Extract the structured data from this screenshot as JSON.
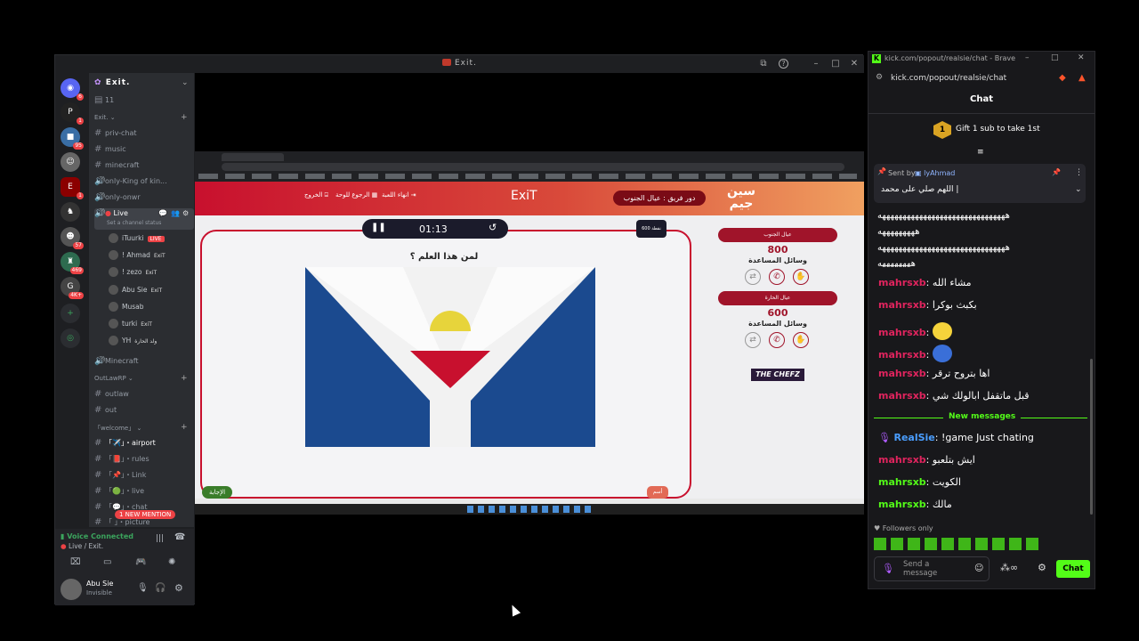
{
  "discord": {
    "window_title": "Exit.",
    "server_name": "Exit.",
    "channels": {
      "c11": "11",
      "category": "Exit.",
      "priv_chat": "priv-chat",
      "music": "music",
      "minecraft": "minecraft",
      "only_king": "only-King of kin...",
      "only_onwr": "only-onwr",
      "live": "Live",
      "live_status": "Set a channel status",
      "minecraft_voice": "Minecraft",
      "outlaw_category": "OutLawRP",
      "outlaw": "outlaw",
      "out": "out",
      "welcome_category": "「welcome」",
      "airport": "「✈️」・airport",
      "rules": "「📕」・rules",
      "link": "「📌」・Link",
      "live2": "「🟢」・live",
      "chat": "「💬」・chat",
      "last": "「 」・picture"
    },
    "voice_users": [
      {
        "name": "iTuurki",
        "tag": "LIVE"
      },
      {
        "name": "! Ahmad",
        "tag": "ExiT"
      },
      {
        "name": "! zezo",
        "tag": "ExiT"
      },
      {
        "name": "Abu Sie",
        "tag": "ExiT"
      },
      {
        "name": "Musab",
        "tag": ""
      },
      {
        "name": "turki",
        "tag": "ExiT"
      },
      {
        "name": "YH",
        "tag": "ولد الحارة"
      }
    ],
    "new_mention": "1 NEW MENTION",
    "voice_connected": "Voice Connected",
    "voice_location": "Live / Exit.",
    "user": {
      "name": "Abu Sie",
      "status": "Invisible"
    },
    "server_badges": [
      "6",
      "1",
      "95",
      "1",
      "57",
      "469",
      "4K+"
    ]
  },
  "game": {
    "title": "ExiT",
    "team_turn": "دور فريق : عيال الجنوب",
    "end_game": "انهاء اللعبة",
    "back_board": "الرجوع للوحة",
    "exit": "الخروج",
    "timer": "01:13",
    "points_badge": "600 نقطة",
    "question": "لمن هذا العلم ؟",
    "answer_btn": "الإجابة",
    "team_btn": "أسم",
    "team1": {
      "name": "عيال الجنوب",
      "score": "800",
      "helpers": "وسائل المساعدة"
    },
    "team2": {
      "name": "عيال الحارة",
      "score": "600",
      "helpers": "وسائل المساعدة"
    },
    "sponsor": "THE CHEFZ",
    "logo": "سين جيم"
  },
  "kick": {
    "window_title": "kick.com/popout/realsie/chat - Brave",
    "url": "kick.com/popout/realsie/chat",
    "header": "Chat",
    "gift_text": "Gift 1 sub to take 1st",
    "pinned_by_label": "Sent by",
    "pinned_user": "lyAhmad",
    "pinned_text": "اللهم صلي على محمد |",
    "spam1": "هههههههههههههههههههههههههههههههه",
    "spam1b": "هههههههههه",
    "spam2": "هههههههههههههههههههههههههههههههه",
    "spam2b": "ههههههههه",
    "new_messages": "New messages",
    "messages": [
      {
        "user": "mahrsxb",
        "text": "مشاء الله",
        "color": "#e0245e"
      },
      {
        "user": "mahrsxb",
        "text": "بكبث بوكرا",
        "color": "#e0245e"
      },
      {
        "user": "mahrsxb",
        "text": "",
        "color": "#e0245e"
      },
      {
        "user": "mahrsxb",
        "text": "",
        "color": "#e0245e"
      },
      {
        "user": "mahrsxb",
        "text": "اها بتروح ترقر",
        "color": "#e0245e"
      },
      {
        "user": "mahrsxb",
        "text": "قبل ماتقفل ابالولك شي",
        "color": "#e0245e"
      },
      {
        "user": "RealSie",
        "text": "!game Just chating",
        "color": "#4a9eff"
      },
      {
        "user": "mahrsxb",
        "text": "ايش بتلعبو",
        "color": "#e0245e"
      },
      {
        "user": "mahrsxb",
        "text": "الكويت",
        "color": "#53fc18"
      },
      {
        "user": "mahrsxb",
        "text": "مالك",
        "color": "#53fc18"
      }
    ],
    "followers_only": "Followers only",
    "input_placeholder": "Send a message",
    "chat_button": "Chat",
    "accent": "#53fc18"
  }
}
